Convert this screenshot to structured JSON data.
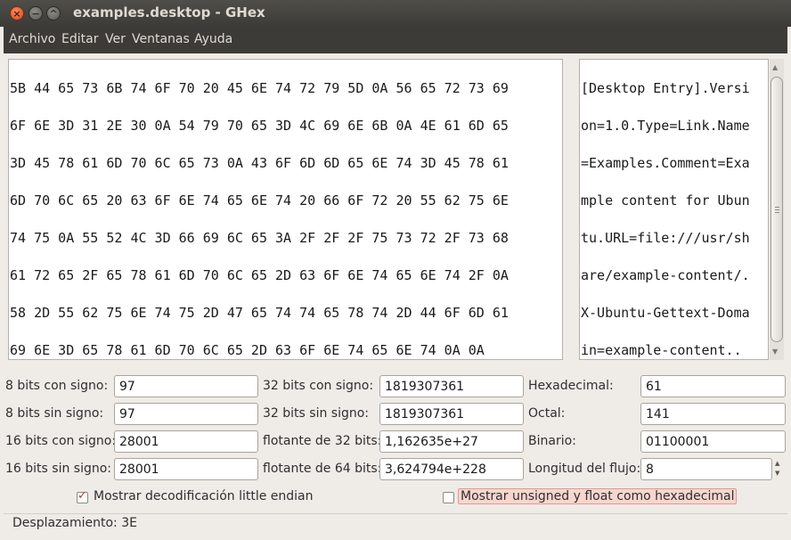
{
  "window": {
    "title": "examples.desktop - GHex",
    "close_glyph": "×",
    "min_glyph": "−",
    "max_glyph": "^"
  },
  "menu": [
    "Archivo",
    "Editar",
    "Ver",
    "Ventanas",
    "Ayuda"
  ],
  "hex_lines": [
    "5B 44 65 73 6B 74 6F 70 20 45 6E 74 72 79 5D 0A 56 65 72 73 69",
    "6F 6E 3D 31 2E 30 0A 54 79 70 65 3D 4C 69 6E 6B 0A 4E 61 6D 65",
    "3D 45 78 61 6D 70 6C 65 73 0A 43 6F 6D 6D 65 6E 74 3D 45 78 61",
    "6D 70 6C 65 20 63 6F 6E 74 65 6E 74 20 66 6F 72 20 55 62 75 6E",
    "74 75 0A 55 52 4C 3D 66 69 6C 65 3A 2F 2F 2F 75 73 72 2F 73 68",
    "61 72 65 2F 65 78 61 6D 70 6C 65 2D 63 6F 6E 74 65 6E 74 2F 0A",
    "58 2D 55 62 75 6E 74 75 2D 47 65 74 74 65 78 74 2D 44 6F 6D 61",
    "69 6E 3D 65 78 61 6D 70 6C 65 2D 63 6F 6E 74 65 6E 74 0A 0A"
  ],
  "ascii_lines": [
    "[Desktop Entry].Versi",
    "on=1.0.Type=Link.Name",
    "=Examples.Comment=Exa",
    "mple content for Ubun",
    "tu.URL=file:///usr/sh",
    "are/example-content/.",
    "X-Ubuntu-Gettext-Doma",
    "in=example-content.."
  ],
  "fields": {
    "s8_label": "8 bits con signo:",
    "s8_value": "97",
    "u8_label": "8 bits sin signo:",
    "u8_value": "97",
    "s16_label": "16 bits con signo:",
    "s16_value": "28001",
    "u16_label": "16 bits sin signo:",
    "u16_value": "28001",
    "s32_label": "32 bits con signo:",
    "s32_value": "1819307361",
    "u32_label": "32 bits sin signo:",
    "u32_value": "1819307361",
    "f32_label": "flotante de 32 bits:",
    "f32_value": "1,162635e+27",
    "f64_label": "flotante de 64 bits:",
    "f64_value": "3,624794e+228",
    "hex_label": "Hexadecimal:",
    "hex_value": "61",
    "oct_label": "Octal:",
    "oct_value": "141",
    "bin_label": "Binario:",
    "bin_value": "01100001",
    "stream_label": "Longitud del flujo:",
    "stream_value": "8"
  },
  "options": {
    "little_endian_label": "Mostrar decodificación little endian",
    "little_endian_checked": true,
    "unsigned_hex_label": "Mostrar unsigned y float como hexadecimal",
    "unsigned_hex_checked": false
  },
  "status": "Desplazamiento: 3E",
  "colors": {
    "titlebar": "#3c3b37",
    "accent": "#d9491a",
    "window_bg": "#efebe7"
  }
}
